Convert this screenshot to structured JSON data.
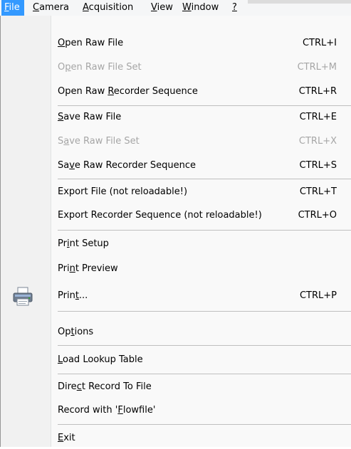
{
  "menubar": {
    "items": [
      {
        "pre": "",
        "acc": "F",
        "post": "ile",
        "active": true
      },
      {
        "pre": "",
        "acc": "C",
        "post": "amera"
      },
      {
        "pre": "",
        "acc": "A",
        "post": "cquisition"
      },
      {
        "pre": "",
        "acc": "V",
        "post": "iew"
      },
      {
        "pre": "",
        "acc": "W",
        "post": "indow"
      },
      {
        "pre": "",
        "acc": "?",
        "post": ""
      }
    ]
  },
  "menu": {
    "items": [
      {
        "pre": "",
        "acc": "O",
        "post": "pen Raw File",
        "shortcut": "CTRL+I",
        "enabled": true
      },
      {
        "pre": "O",
        "acc": "p",
        "post": "en Raw File Set",
        "shortcut": "CTRL+M",
        "enabled": false
      },
      {
        "pre": "Open Raw ",
        "acc": "R",
        "post": "ecorder Sequence",
        "shortcut": "CTRL+R",
        "enabled": true
      },
      {
        "pre": "",
        "acc": "S",
        "post": "ave Raw File",
        "shortcut": "CTRL+E",
        "enabled": true
      },
      {
        "pre": "S",
        "acc": "a",
        "post": "ve Raw File Set",
        "shortcut": "CTRL+X",
        "enabled": false
      },
      {
        "pre": "Sa",
        "acc": "v",
        "post": "e Raw Recorder Sequence",
        "shortcut": "CTRL+S",
        "enabled": true
      },
      {
        "pre": "Export File (not reloadable!)",
        "acc": "",
        "post": "",
        "shortcut": "CTRL+T",
        "enabled": true
      },
      {
        "pre": "Export Recorder Sequence (not reloadable!)",
        "acc": "",
        "post": "",
        "shortcut": "CTRL+O",
        "enabled": true
      },
      {
        "pre": "Pr",
        "acc": "i",
        "post": "nt Setup",
        "shortcut": "",
        "enabled": true
      },
      {
        "pre": "Pri",
        "acc": "n",
        "post": "t Preview",
        "shortcut": "",
        "enabled": true
      },
      {
        "pre": "Prin",
        "acc": "t",
        "post": "...",
        "shortcut": "CTRL+P",
        "enabled": true,
        "icon": "printer-icon"
      },
      {
        "pre": "Op",
        "acc": "t",
        "post": "ions",
        "shortcut": "",
        "enabled": true
      },
      {
        "pre": "",
        "acc": "L",
        "post": "oad Lookup Table",
        "shortcut": "",
        "enabled": true
      },
      {
        "pre": "Dire",
        "acc": "c",
        "post": "t Record To File",
        "shortcut": "",
        "enabled": true
      },
      {
        "pre": "Record with '",
        "acc": "F",
        "post": "lowfile'",
        "shortcut": "",
        "enabled": true
      },
      {
        "pre": "",
        "acc": "E",
        "post": "xit",
        "shortcut": "",
        "enabled": true
      }
    ]
  },
  "colors": {
    "highlight": "#3399ff",
    "disabled_text": "#a6a6a6",
    "separator": "#bfbfbf"
  }
}
